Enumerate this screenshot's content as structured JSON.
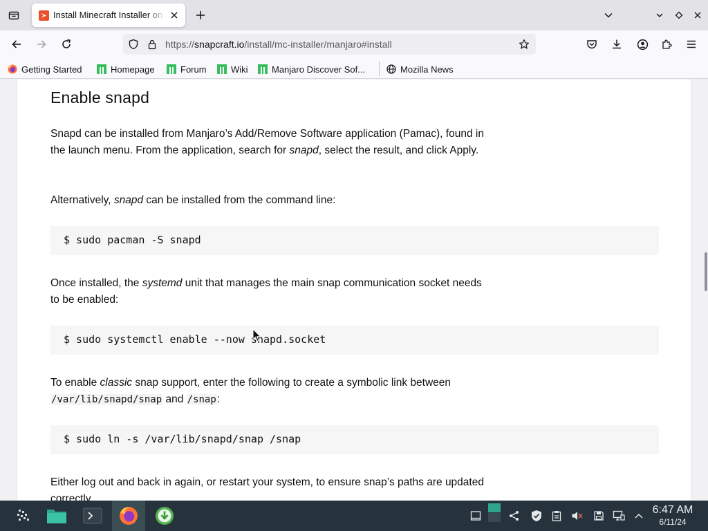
{
  "browser": {
    "tab": {
      "title": "Install Minecraft Installer on Manjaro",
      "favicon": "snapcraft-icon"
    },
    "url": {
      "prefix": "https://",
      "host": "snapcraft.io",
      "path": "/install/mc-installer/manjaro#install"
    },
    "bookmarks": [
      {
        "label": "Getting Started",
        "icon": "firefox-icon"
      },
      {
        "label": "Homepage",
        "icon": "manjaro-icon"
      },
      {
        "label": "Forum",
        "icon": "manjaro-icon"
      },
      {
        "label": "Wiki",
        "icon": "manjaro-icon"
      },
      {
        "label": "Manjaro Discover Sof...",
        "icon": "manjaro-icon"
      },
      {
        "label": "Mozilla News",
        "icon": "globe-icon"
      }
    ]
  },
  "page": {
    "heading": "Enable snapd",
    "p1": {
      "a": "Snapd can be installed from Manjaro’s Add/Remove Software application (Pamac), found in the launch menu. From the application, search for ",
      "em": "snapd",
      "b": ", select the result, and click Apply."
    },
    "p2": {
      "a": "Alternatively, ",
      "em": "snapd",
      "b": " can be installed from the command line:"
    },
    "code1": "$ sudo pacman -S snapd",
    "p3": {
      "a": "Once installed, the ",
      "em": "systemd",
      "b": " unit that manages the main snap communication socket needs to be enabled:"
    },
    "code2": "$ sudo systemctl enable --now snapd.socket",
    "p4": {
      "a": "To enable ",
      "em": "classic",
      "b": " snap support, enter the following to create a symbolic link between ",
      "code1": "/var/lib/snapd/snap",
      "c": " and ",
      "code2": "/snap",
      "d": ":"
    },
    "code3": "$ sudo ln -s /var/lib/snapd/snap /snap",
    "p5": "Either log out and back in again, or restart your system, to ensure snap’s paths are updated correctly."
  },
  "taskbar": {
    "time": "6:47 AM",
    "date": "6/11/24"
  },
  "colors": {
    "taskbar_bg": "#27333c",
    "manjaro_green": "#35bf5c",
    "snapcraft_orange": "#e9512d",
    "code_bg": "#f6f6f6"
  }
}
